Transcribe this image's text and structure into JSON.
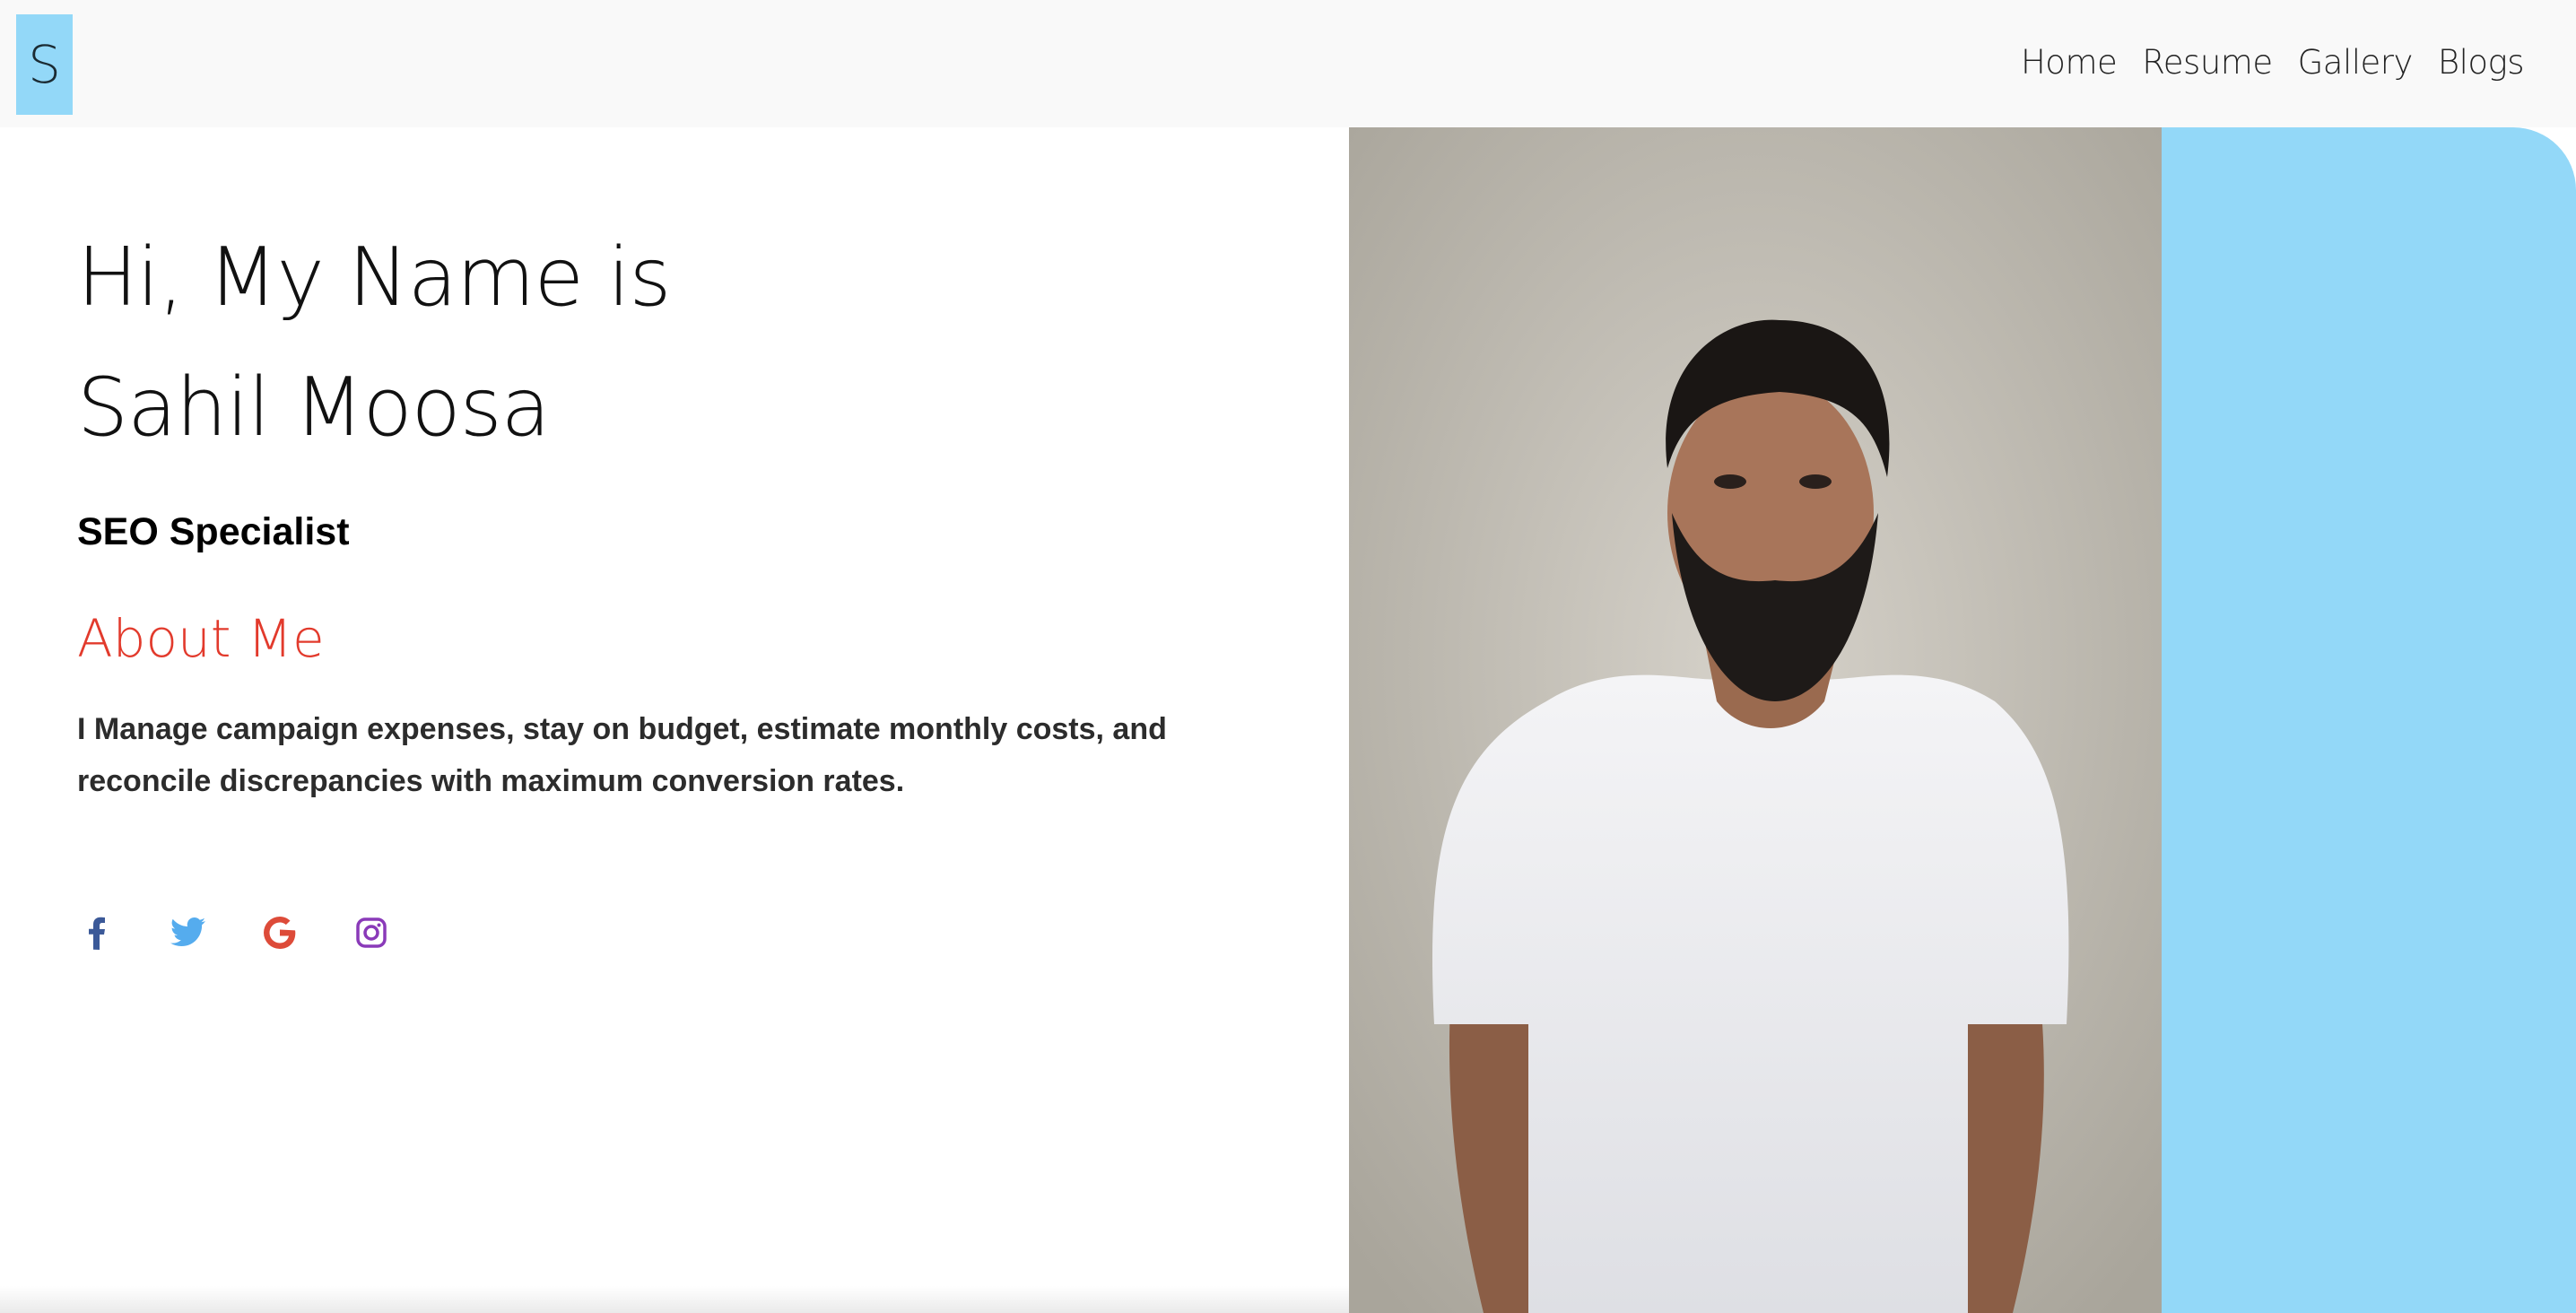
{
  "header": {
    "logo_letter": "S",
    "nav": [
      "Home",
      "Resume",
      "Gallery",
      "Blogs"
    ]
  },
  "hero": {
    "greeting_line1": "Hi, My Name is",
    "greeting_line2": "Sahil Moosa",
    "role": "SEO Specialist",
    "about_heading": "About Me",
    "bio": "I Manage campaign expenses, stay on budget, estimate monthly costs, and reconcile discrepancies with maximum conversion rates."
  },
  "social": [
    {
      "icon": "facebook-icon",
      "color": "#3b5998"
    },
    {
      "icon": "twitter-icon",
      "color": "#55acee"
    },
    {
      "icon": "google-icon",
      "color": "#dd4b39"
    },
    {
      "icon": "instagram-icon",
      "color": "#8a3ab9"
    }
  ],
  "colors": {
    "accent_blue": "#93d8f8",
    "about_red": "#e23a2c",
    "header_bg": "#f9f9f9"
  }
}
